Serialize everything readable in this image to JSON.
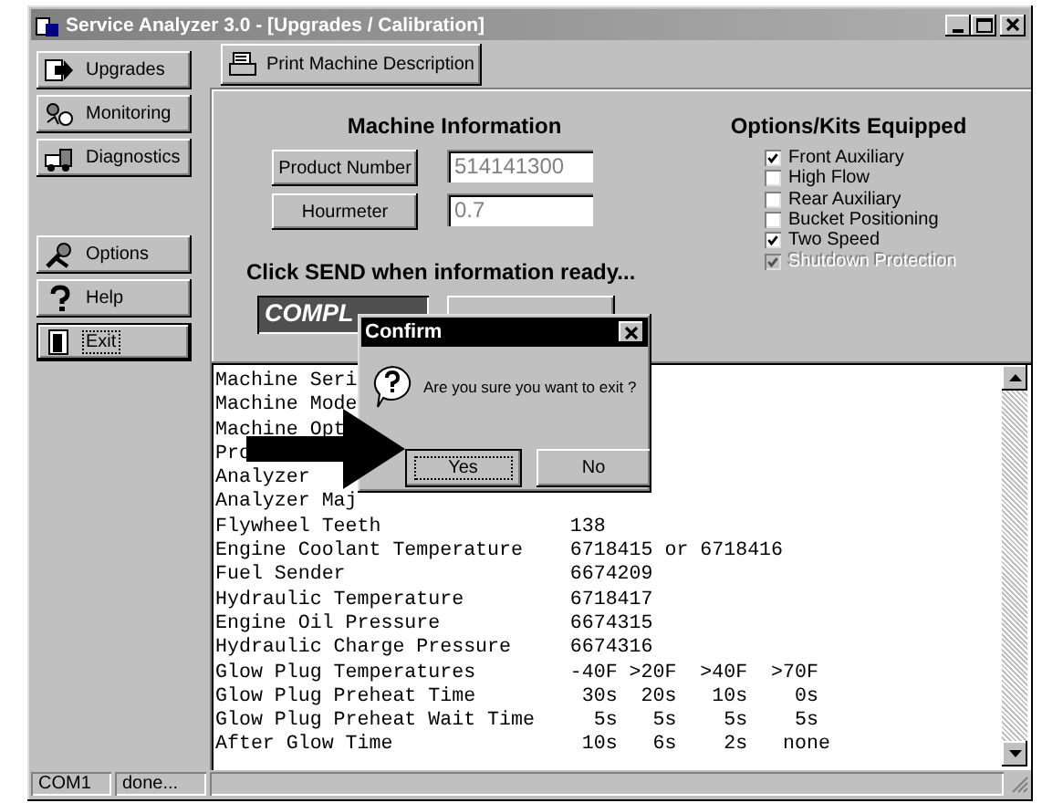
{
  "window": {
    "title": "Service Analyzer 3.0 - [Upgrades / Calibration]"
  },
  "sidebar": {
    "items": [
      {
        "kind": "upgrades",
        "label": "Upgrades",
        "focused": false
      },
      {
        "kind": "monitoring",
        "label": "Monitoring",
        "focused": false
      },
      {
        "kind": "diagnostics",
        "label": "Diagnostics",
        "focused": false
      },
      {
        "kind": "options",
        "label": "Options",
        "focused": false
      },
      {
        "kind": "help",
        "label": "Help",
        "focused": false
      },
      {
        "kind": "exit",
        "label": "Exit",
        "focused": true
      }
    ]
  },
  "toolbar": {
    "print_button": "Print Machine Description"
  },
  "machine_info": {
    "heading": "Machine Information",
    "fields": [
      {
        "button": "Product Number",
        "value": "514141300"
      },
      {
        "button": "Hourmeter",
        "value": "0.7"
      }
    ],
    "prompt": "Click SEND when information ready...",
    "status": "COMPL"
  },
  "options_kits": {
    "heading": "Options/Kits Equipped",
    "items": [
      {
        "label": "Front Auxiliary",
        "checked": true,
        "disabled": false
      },
      {
        "label": "High Flow",
        "checked": false,
        "disabled": false
      },
      {
        "label": "Rear Auxiliary",
        "checked": false,
        "disabled": false
      },
      {
        "label": "Bucket Positioning",
        "checked": false,
        "disabled": false
      },
      {
        "label": "Two Speed",
        "checked": true,
        "disabled": false
      },
      {
        "label": "Shutdown Protection",
        "checked": true,
        "disabled": true
      }
    ]
  },
  "report": {
    "lines": [
      "Machine Seri",
      "Machine Mode",
      "Machine Opt",
      "Pro",
      "Analyzer",
      "Analyzer Maj",
      "Flywheel Teeth                138",
      "Engine Coolant Temperature    6718415 or 6718416",
      "Fuel Sender                   6674209",
      "Hydraulic Temperature         6718417",
      "Engine Oil Pressure           6674315",
      "Hydraulic Charge Pressure     6674316",
      "Glow Plug Temperatures        -40F >20F  >40F  >70F",
      "Glow Plug Preheat Time         30s  20s   10s    0s",
      "Glow Plug Preheat Wait Time     5s   5s    5s    5s",
      "After Glow Time                10s   6s    2s   none"
    ]
  },
  "dialog": {
    "title": "Confirm",
    "message": "Are you sure you want to exit ?",
    "buttons": [
      {
        "label": "Yes",
        "focused": true
      },
      {
        "label": "No",
        "focused": false
      }
    ]
  },
  "status_bar": {
    "panels": [
      "COM1",
      "done..."
    ]
  }
}
